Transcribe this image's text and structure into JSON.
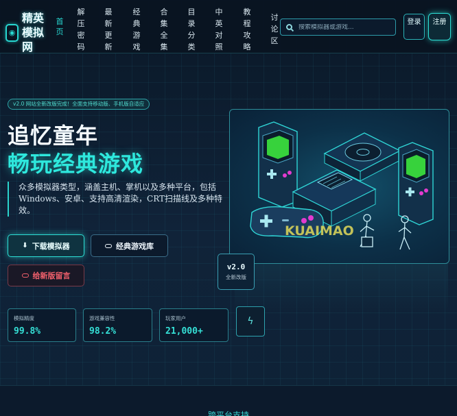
{
  "site": {
    "logo_text": "精英模拟网",
    "logo_icon": "gamepad-icon"
  },
  "nav": {
    "home": "首页",
    "items": [
      "解压密码",
      "最新更新",
      "经典游戏",
      "合集全集",
      "目录分类",
      "中英对照",
      "教程攻略",
      "讨论区"
    ]
  },
  "search": {
    "placeholder": "搜索模拟器或游戏..."
  },
  "auth": {
    "login": "登录",
    "register": "注册"
  },
  "hero": {
    "announcement": "v2.0 网站全新改版完成！全面支持移动版、手机版自适应",
    "title_line1": "追忆童年",
    "title_line2": "畅玩经典游戏",
    "description": "众多模拟器类型，涵盖主机、掌机以及多种平台，包括Windows、安卓、支持高清渲染，CRT扫描线及多种特效。",
    "buttons": {
      "download": "下载模拟器",
      "library": "经典游戏库",
      "message": "给新版留言"
    }
  },
  "stats": [
    {
      "label": "模拟精度",
      "value": "99.8%"
    },
    {
      "label": "游戏兼容性",
      "value": "98.2%"
    },
    {
      "label": "玩家用户",
      "value": "21,000+"
    }
  ],
  "version_badge": {
    "version": "v2.0",
    "label": "全新改版"
  },
  "illustration": {
    "watermark": "KUAIMAO"
  },
  "section": {
    "title": "跨平台支持"
  },
  "colors": {
    "accent": "#2ee8dd",
    "background": "#0f1f33",
    "danger": "#f2606c"
  }
}
